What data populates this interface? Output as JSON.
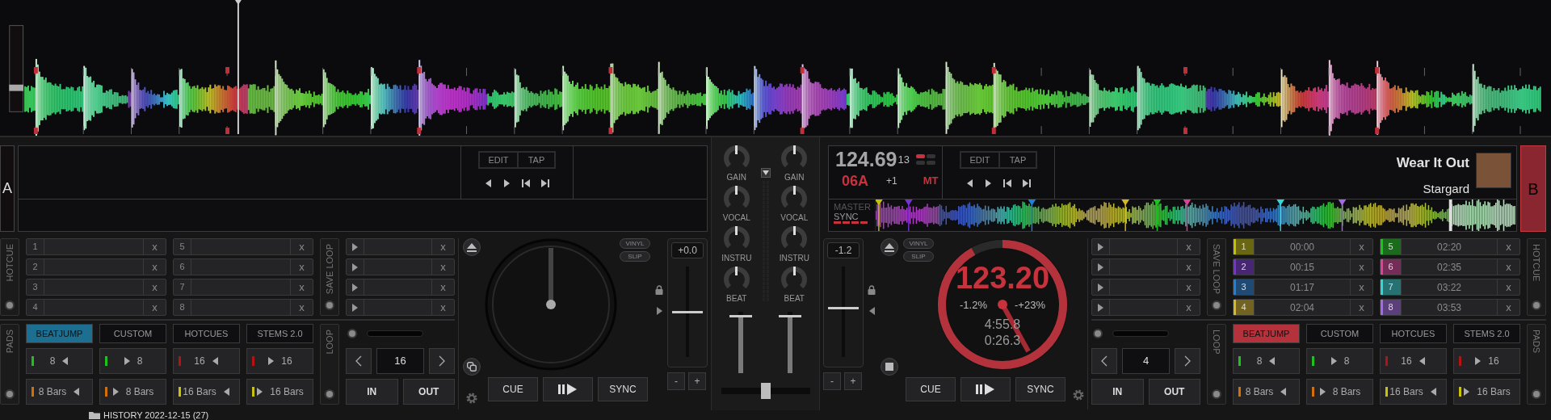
{
  "decks": [
    {
      "letter": "A",
      "edit": "EDIT",
      "tap": "TAP",
      "hotcue_label": "HOTCUE",
      "hotcues": [
        {
          "number": "1",
          "delete": "x"
        },
        {
          "number": "2",
          "delete": "x"
        },
        {
          "number": "3",
          "delete": "x"
        },
        {
          "number": "4",
          "delete": "x"
        },
        {
          "number": "5",
          "delete": "x"
        },
        {
          "number": "6",
          "delete": "x"
        },
        {
          "number": "7",
          "delete": "x"
        },
        {
          "number": "8",
          "delete": "x"
        }
      ],
      "save_loop_label": "SAVE LOOP",
      "saved_loops": [
        {
          "delete": "x"
        },
        {
          "delete": "x"
        },
        {
          "delete": "x"
        },
        {
          "delete": "x"
        }
      ],
      "pads_label": "PADS",
      "pad_pages": [
        {
          "label": "BEATJUMP",
          "selected": true
        },
        {
          "label": "CUSTOM",
          "selected": false
        },
        {
          "label": "HOTCUES",
          "selected": false
        },
        {
          "label": "STEMS 2.0",
          "selected": false
        }
      ],
      "pads": [
        {
          "label": "8",
          "kind": "back",
          "color": "#1fc01f"
        },
        {
          "label": "8",
          "kind": "forward",
          "color": "#1fc01f"
        },
        {
          "label": "16",
          "kind": "back",
          "color": "#b01414"
        },
        {
          "label": "16",
          "kind": "forward",
          "color": "#b01414"
        },
        {
          "label": "8 Bars",
          "kind": "back",
          "color": "#d0700a"
        },
        {
          "label": "8 Bars",
          "kind": "forward",
          "color": "#d0700a"
        },
        {
          "label": "16 Bars",
          "kind": "back",
          "color": "#c8c20a"
        },
        {
          "label": "16 Bars",
          "kind": "forward",
          "color": "#c8c20a"
        }
      ],
      "loop_label": "LOOP",
      "loop_size": "16",
      "loop_in": "IN",
      "loop_out": "OUT",
      "vinyl": "VINYL",
      "slip": "SLIP",
      "pitch": {
        "reading": "+0.0",
        "level": 0.5
      },
      "pitch_minus": "-",
      "pitch_plus": "+",
      "cue": "CUE",
      "sync": "SYNC",
      "jog": {
        "kind": "empty"
      }
    },
    {
      "letter": "B",
      "bpm": "124.69",
      "beat": "13",
      "key": "06A",
      "key_shift": "+1",
      "mt": "MT",
      "edit": "EDIT",
      "tap": "TAP",
      "title": "Wear It Out",
      "artist": "Stargard",
      "master": "MASTER",
      "sync_state": "SYNC",
      "hotcue_label": "HOTCUE",
      "hotcues": [
        {
          "number": "1",
          "time": "00:00",
          "color": "#c4c000",
          "delete": "x"
        },
        {
          "number": "2",
          "time": "00:15",
          "color": "#7a30d8",
          "delete": "x"
        },
        {
          "number": "3",
          "time": "01:17",
          "color": "#1e80d8",
          "delete": "x"
        },
        {
          "number": "4",
          "time": "02:04",
          "color": "#d8b820",
          "delete": "x"
        },
        {
          "number": "5",
          "time": "02:20",
          "color": "#18c818",
          "delete": "x"
        },
        {
          "number": "6",
          "time": "02:35",
          "color": "#e0409a",
          "delete": "x"
        },
        {
          "number": "7",
          "time": "03:22",
          "color": "#30d8d8",
          "delete": "x"
        },
        {
          "number": "8",
          "time": "03:53",
          "color": "#a468e8",
          "delete": "x"
        }
      ],
      "save_loop_label": "SAVE LOOP",
      "saved_loops": [
        {
          "delete": "x"
        },
        {
          "delete": "x"
        },
        {
          "delete": "x"
        },
        {
          "delete": "x"
        }
      ],
      "pads_label": "PADS",
      "pad_pages": [
        {
          "label": "BEATJUMP",
          "selected": true
        },
        {
          "label": "CUSTOM",
          "selected": false
        },
        {
          "label": "HOTCUES",
          "selected": false
        },
        {
          "label": "STEMS 2.0",
          "selected": false
        }
      ],
      "pads": [
        {
          "label": "8",
          "kind": "back",
          "color": "#1fc01f"
        },
        {
          "label": "8",
          "kind": "forward",
          "color": "#1fc01f"
        },
        {
          "label": "16",
          "kind": "back",
          "color": "#b01414"
        },
        {
          "label": "16",
          "kind": "forward",
          "color": "#b01414"
        },
        {
          "label": "8 Bars",
          "kind": "back",
          "color": "#d0700a"
        },
        {
          "label": "8 Bars",
          "kind": "forward",
          "color": "#d0700a"
        },
        {
          "label": "16 Bars",
          "kind": "back",
          "color": "#c8c20a"
        },
        {
          "label": "16 Bars",
          "kind": "forward",
          "color": "#c8c20a"
        }
      ],
      "loop_label": "LOOP",
      "loop_size": "4",
      "loop_in": "IN",
      "loop_out": "OUT",
      "vinyl": "VINYL",
      "slip": "SLIP",
      "pitch": {
        "reading": "-1.2",
        "level": 0.54
      },
      "pitch_minus": "-",
      "pitch_plus": "+",
      "cue": "CUE",
      "sync": "SYNC",
      "jog": {
        "kind": "track",
        "bpm": "123.20",
        "pitch": "-1.2%",
        "range": "-+23%",
        "remaining": "4:55.8",
        "elapsed": "0:26.3",
        "level": 0.92
      }
    }
  ],
  "mixer": {
    "channels": [
      {
        "knobs": [
          {
            "label": "GAIN",
            "level": 0.5
          },
          {
            "label": "VOCAL",
            "level": 0.5
          },
          {
            "label": "INSTRU",
            "level": 0.5
          },
          {
            "label": "BEAT",
            "level": 0.5
          }
        ],
        "volume": {
          "level": 0.95
        }
      },
      {
        "knobs": [
          {
            "label": "GAIN",
            "level": 0.5
          },
          {
            "label": "VOCAL",
            "level": 0.5
          },
          {
            "label": "INSTRU",
            "level": 0.5
          },
          {
            "label": "BEAT",
            "level": 0.5
          }
        ],
        "volume": {
          "level": 0.95
        }
      }
    ],
    "crossfader": {
      "level": 0.5
    }
  },
  "browser": {
    "folder": "HISTORY 2022-12-15 (27)"
  }
}
